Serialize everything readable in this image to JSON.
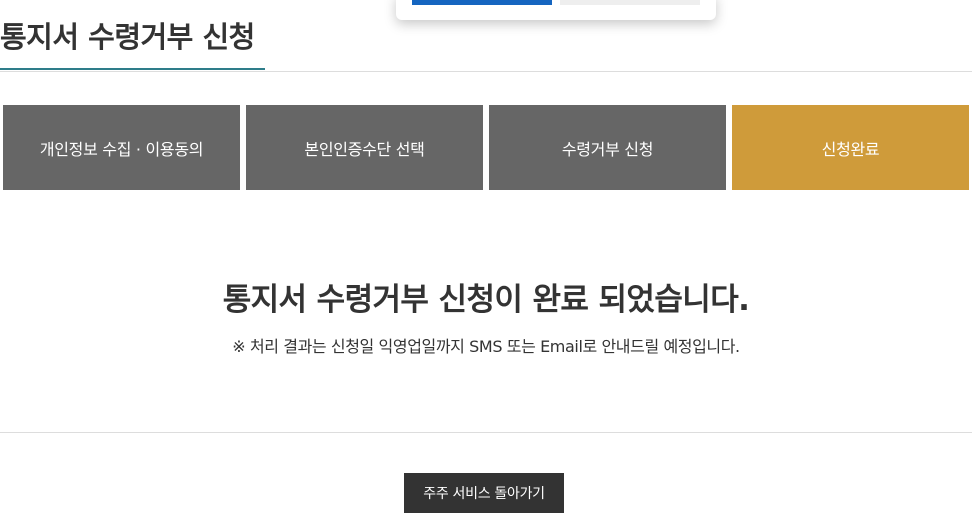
{
  "popup": {
    "primary_button_label": "",
    "secondary_button_label": ""
  },
  "header": {
    "title": "통지서 수령거부 신청"
  },
  "steps": [
    {
      "label": "개인정보 수집 · 이용동의",
      "active": false
    },
    {
      "label": "본인인증수단 선택",
      "active": false
    },
    {
      "label": "수령거부 신청",
      "active": false
    },
    {
      "label": "신청완료",
      "active": true
    }
  ],
  "result": {
    "title": "통지서 수령거부 신청이 완료 되었습니다.",
    "description": "※ 처리 결과는 신청일 익영업일까지 SMS 또는 Email로 안내드릴 예정입니다."
  },
  "footer": {
    "back_button_label": "주주 서비스 돌아가기"
  },
  "colors": {
    "step_inactive": "#666666",
    "step_active": "#cf9b3a",
    "title_underline": "#2e7d8a",
    "button_dark": "#333333",
    "popup_primary": "#1565c0"
  }
}
